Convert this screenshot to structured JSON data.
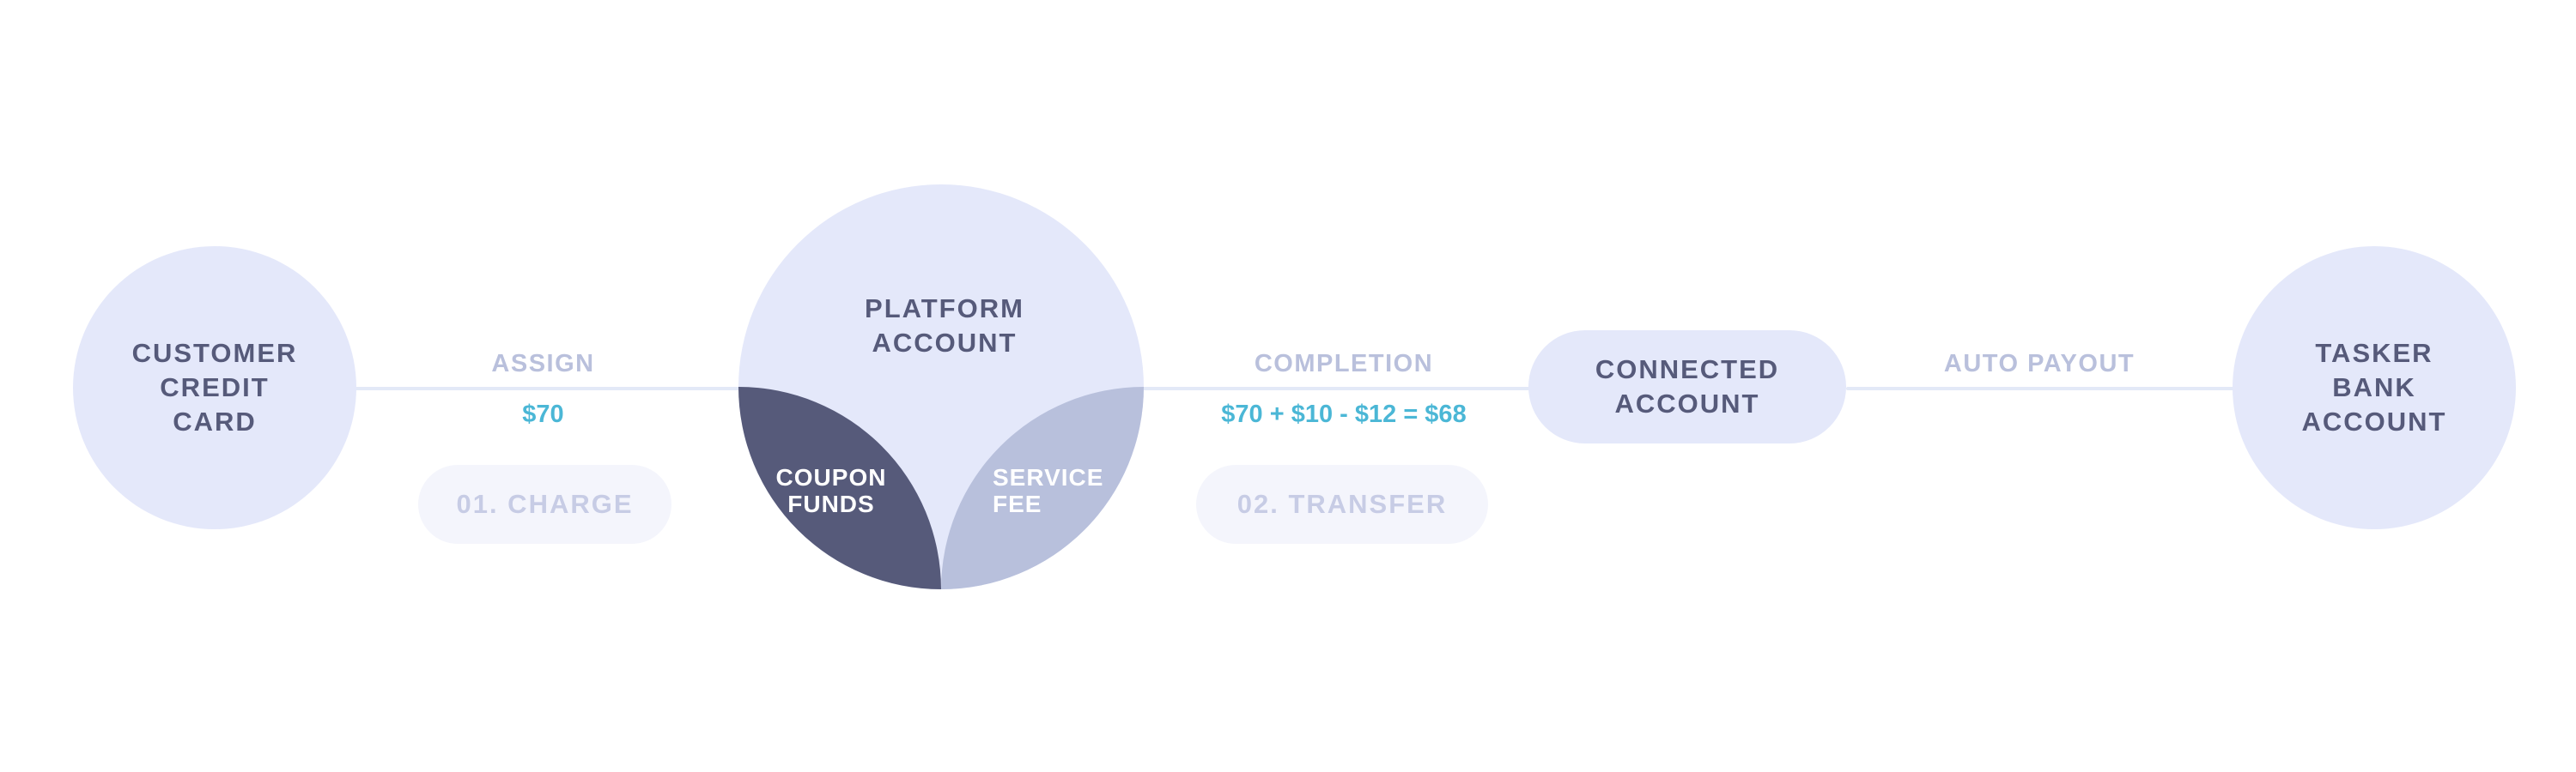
{
  "nodes": {
    "customer_credit_card": "CUSTOMER\nCREDIT\nCARD",
    "platform_account": "PLATFORM\nACCOUNT",
    "connected_account": "CONNECTED\nACCOUNT",
    "tasker_bank_account": "TASKER\nBANK\nACCOUNT"
  },
  "platform_segments": {
    "coupon_funds": "COUPON\nFUNDS",
    "service_fee": "SERVICE\nFEE"
  },
  "flows": {
    "assign": {
      "label": "ASSIGN",
      "amount": "$70",
      "step": "01. CHARGE"
    },
    "completion": {
      "label": "COMPLETION",
      "amount": "$70 + $10 - $12 = $68",
      "step": "02. TRANSFER"
    },
    "auto_payout": {
      "label": "AUTO PAYOUT"
    }
  },
  "colors": {
    "node_fill": "#e4e8fa",
    "node_text": "#565a7a",
    "coupon_segment": "#565a7a",
    "service_segment": "#b8c0dc",
    "flow_label": "#b9c0dc",
    "amount_text": "#4bb7d6",
    "step_badge_fill": "#f4f5fc",
    "step_badge_text": "#c7cce5",
    "connector": "#e3e9f7"
  }
}
